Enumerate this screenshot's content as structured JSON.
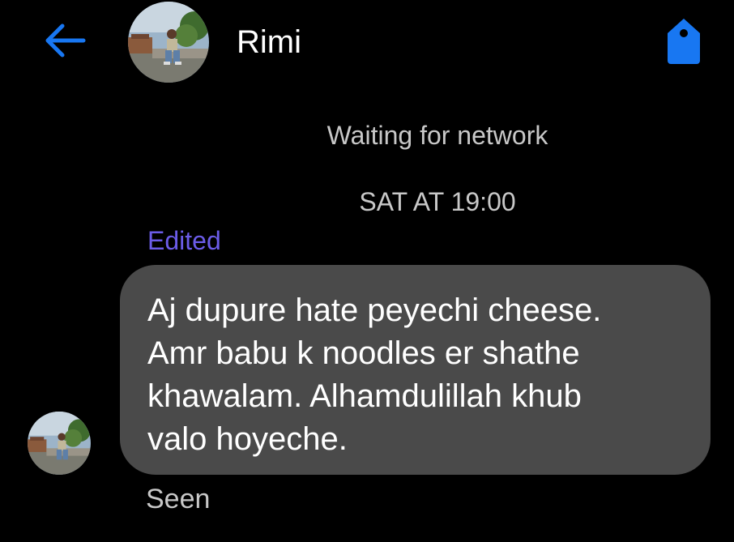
{
  "header": {
    "back_icon": "arrow-left-icon",
    "contact_name": "Rimi",
    "tag_icon": "price-tag-icon",
    "accent_color": "#1877f2"
  },
  "conversation": {
    "network_status": "Waiting for network",
    "timestamp": "SAT AT 19:00",
    "edited_label": "Edited",
    "message_text": "Aj dupure hate peyechi cheese.\nAmr babu k noodles er shathe\nkhawalam. Alhamdulillah khub\nvalo hoyeche.",
    "seen_label": "Seen"
  },
  "colors": {
    "background": "#000000",
    "bubble": "#4a4a4a",
    "edited": "#6b5ce8",
    "meta_text": "#c8c8c8"
  }
}
